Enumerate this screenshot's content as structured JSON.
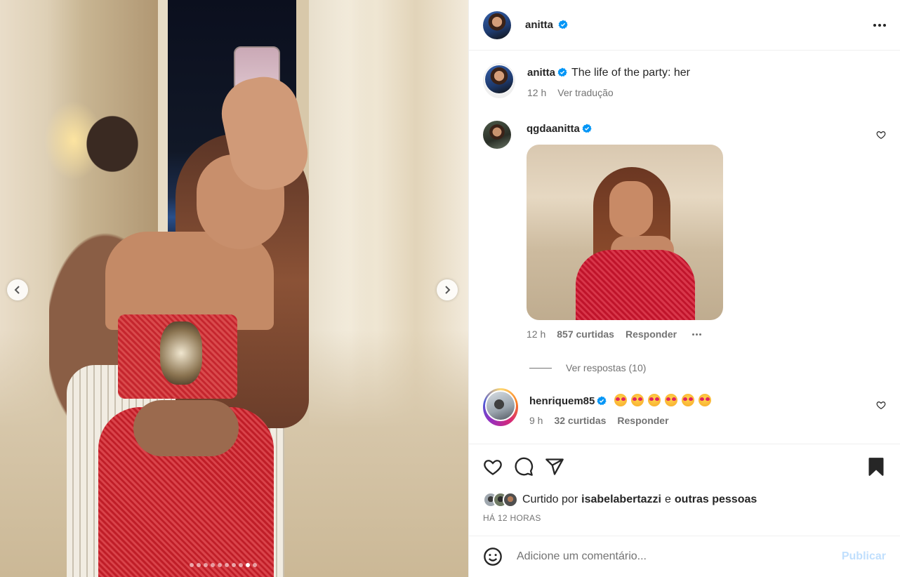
{
  "post": {
    "author": "anitta",
    "caption_author": "anitta",
    "caption": "The life of the party: her",
    "caption_time": "12 h",
    "translate_label": "Ver tradução",
    "carousel_dots": 10,
    "carousel_active_index": 8
  },
  "comments": [
    {
      "username": "qgdaanitta",
      "verified": true,
      "has_sticker": true,
      "time": "12 h",
      "likes": "857 curtidas",
      "reply_label": "Responder",
      "view_replies": "Ver respostas (10)"
    },
    {
      "username": "henriquem85",
      "verified": true,
      "emojis": [
        "heart-eyes",
        "heart-eyes",
        "heart-eyes",
        "heart-eyes",
        "heart-eyes",
        "heart-eyes"
      ],
      "time": "9 h",
      "likes": "32 curtidas",
      "reply_label": "Responder"
    }
  ],
  "likes_summary": {
    "prefix": "Curtido por",
    "user": "isabelabertazzi",
    "conj": "e",
    "others": "outras pessoas"
  },
  "timestamp": "HÁ 12 HORAS",
  "composer": {
    "placeholder": "Adicione um comentário...",
    "publish_label": "Publicar"
  },
  "icons": {
    "verified": "verified-badge-icon",
    "more": "more-options-icon",
    "like": "heart-icon",
    "comment": "comment-icon",
    "share": "share-icon",
    "save": "bookmark-icon",
    "emoji": "emoji-icon",
    "prev": "chevron-left-icon",
    "next": "chevron-right-icon"
  },
  "colors": {
    "verified_blue": "#0095f6",
    "publish_disabled": "#c0dffd",
    "text_secondary": "#737373"
  }
}
